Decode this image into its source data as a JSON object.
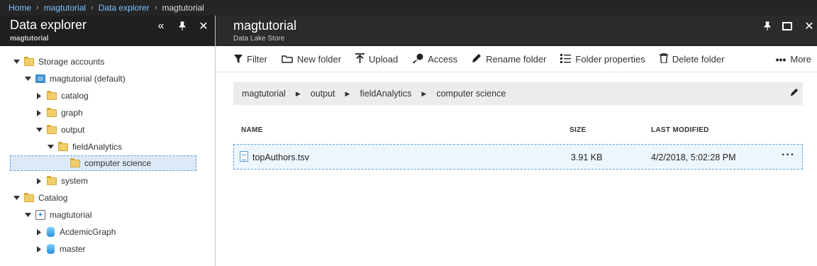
{
  "breadcrumb": {
    "items": [
      "Home",
      "magtutorial",
      "Data explorer"
    ],
    "current": "magtutorial"
  },
  "left_panel": {
    "title": "Data explorer",
    "subtitle": "magtutorial",
    "icons": {
      "collapse": "«",
      "pin": "pin-icon",
      "close": "✕"
    }
  },
  "tree": {
    "storage_accounts": "Storage accounts",
    "magtutorial_default": "magtutorial (default)",
    "catalog": "catalog",
    "graph": "graph",
    "output": "output",
    "fieldAnalytics": "fieldAnalytics",
    "computer_science": "computer science",
    "system": "system",
    "catalog_root": "Catalog",
    "catalog_magtutorial": "magtutorial",
    "acdemic_graph": "AcdemicGraph",
    "master": "master"
  },
  "right_panel": {
    "title": "magtutorial",
    "subtitle": "Data Lake Store"
  },
  "toolbar": {
    "filter": "Filter",
    "new_folder": "New folder",
    "upload": "Upload",
    "access": "Access",
    "rename_folder": "Rename folder",
    "folder_properties": "Folder properties",
    "delete_folder": "Delete folder",
    "more": "More"
  },
  "path": [
    "magtutorial",
    "output",
    "fieldAnalytics",
    "computer science"
  ],
  "table": {
    "columns": {
      "name": "NAME",
      "size": "SIZE",
      "last_modified": "LAST MODIFIED"
    },
    "rows": [
      {
        "name": "topAuthors.tsv",
        "size": "3.91 KB",
        "last_modified": "4/2/2018, 5:02:28 PM"
      }
    ]
  },
  "accent_color": "#7cc0ff"
}
